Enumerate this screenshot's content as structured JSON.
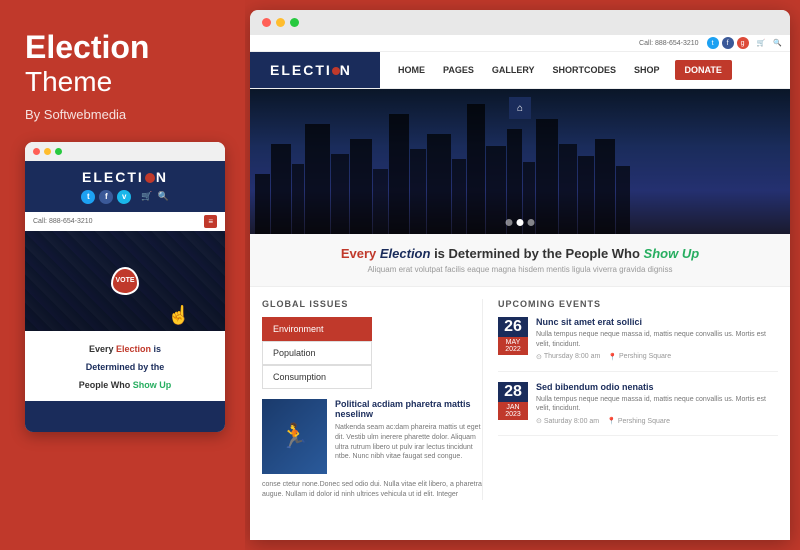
{
  "left": {
    "title_bold": "Election",
    "title_light": "Theme",
    "author": "By Softwebmedia",
    "mobile_logo": "ELECTI",
    "mobile_phone": "Call: 888-654-3210",
    "tagline": {
      "every": "Every ",
      "election": "Election",
      "is": " is",
      "determined": " Determined by the",
      "people": " People Who ",
      "show": "Show Up"
    }
  },
  "right": {
    "header_top": "Call: 888-654-3210",
    "logo": "ELECTI",
    "nav_items": [
      "HOME",
      "PAGES",
      "GALLERY",
      "SHORTCODES",
      "SHOP"
    ],
    "donate_label": "DONATE",
    "tagline": {
      "every": "Every ",
      "election": "Election",
      "is_det": " is Determined by the People Who ",
      "show": "Show Up"
    },
    "tagline_sub": "Aliquam erat volutpat facilis eaque magna hisdem mentis ligula viverra gravida digniss",
    "global_issues": {
      "label": "GLOBAL ISSUES",
      "items": [
        "Environment",
        "Population",
        "Consumption"
      ],
      "active_item": "Environment",
      "article_title": "Political acdiam pharetra mattis neselinw",
      "article_body": "Natkenda seam ac:dam phareira mattis ut eget dit. Vestib ulm inerere pharette dolor. Aliquam ultra rutrum libero ut pulv irar lectus tincidunt ntbe. Nunc nibh vitae faugat sed congue.",
      "article_footer": "conse ctetur none.Donec sed odio dui. Nulla vitae elit libero, a pharetra augue. Nullam id dolor id ninh ultrices vehicula ut id elit. Integer"
    },
    "upcoming_events": {
      "label": "UPCOMING EVENTS",
      "events": [
        {
          "day": "26",
          "month": "MAY",
          "year": "2022",
          "title": "Nunc sit amet erat sollici",
          "desc": "Nulla tempus neque neque massa id, mattis neque convallis us. Mortis est velit, tincidunt.",
          "time": "Thursday  8:00 am",
          "location": "Pershing Square"
        },
        {
          "day": "28",
          "month": "JAN",
          "year": "2023",
          "title": "Sed bibendum odio nenatis",
          "desc": "Nulla tempus neque neque massa id, mattis neque convallis us. Mortis est velit, tincidunt.",
          "time": "Saturday  8:00 am",
          "location": "Pershing Square"
        }
      ]
    }
  }
}
